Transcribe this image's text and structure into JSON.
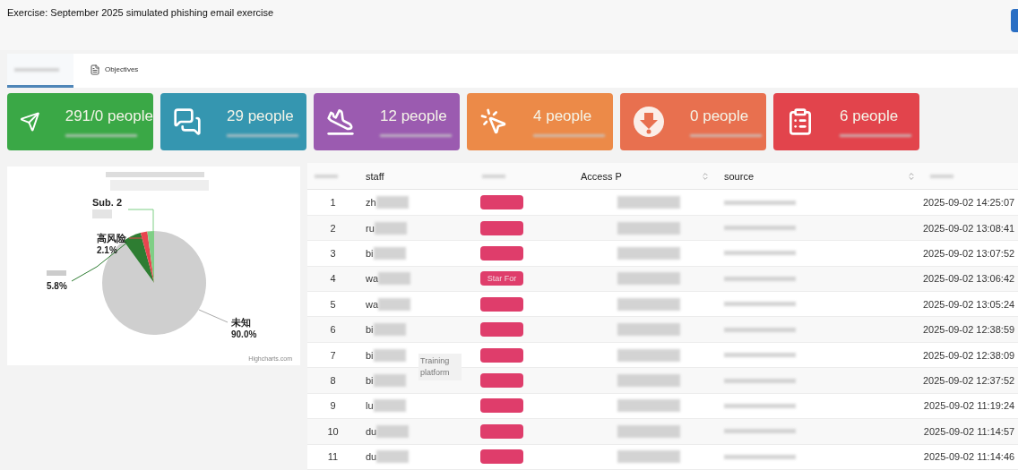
{
  "header": {
    "title": "Exercise: September 2025 simulated phishing email exercise"
  },
  "tabs": [
    {
      "selected": true
    },
    {
      "label": "Objectives",
      "selected": false
    }
  ],
  "cards": [
    {
      "kind": "sent",
      "value": "291/0 people",
      "color": "#3aa846"
    },
    {
      "kind": "opened",
      "value": "29 people",
      "color": "#3596b0"
    },
    {
      "kind": "landed",
      "value": "12 people",
      "color": "#9b5bb0"
    },
    {
      "kind": "clicked",
      "value": "4 people",
      "color": "#ec8a48"
    },
    {
      "kind": "downloaded",
      "value": "0 people",
      "color": "#e8704f"
    },
    {
      "kind": "reported",
      "value": "6 people",
      "color": "#e2444c"
    }
  ],
  "pie": {
    "credit": "Highcharts.com",
    "chart_data": {
      "type": "pie",
      "categories": [
        "未知",
        null,
        "高风险",
        "Sub. 2"
      ],
      "values": [
        90.0,
        5.8,
        2.1,
        2.1
      ],
      "value_labels": [
        "90.0%",
        "5.8%",
        "2.1%",
        null
      ],
      "colors": [
        "#cfcfcf",
        "#2e7d32",
        "#e8454f",
        "#7fcf86"
      ]
    }
  },
  "table": {
    "columns": [
      {
        "sortable": false
      },
      {
        "label": "staff",
        "sortable": false
      },
      {
        "sortable": false
      },
      {
        "label": "Access P",
        "sortable": true
      },
      {
        "label": "source",
        "sortable": true
      },
      {
        "sortable": false
      }
    ],
    "rows": [
      {
        "index": "1",
        "staff": "zh",
        "time": "2025-09-02 14:25:07"
      },
      {
        "index": "2",
        "staff": "ru",
        "time": "2025-09-02 13:08:41"
      },
      {
        "index": "3",
        "staff": "bi",
        "time": "2025-09-02 13:07:52"
      },
      {
        "index": "4",
        "staff": "wa",
        "badge": "Star For",
        "time": "2025-09-02 13:06:42"
      },
      {
        "index": "5",
        "staff": "wa",
        "time": "2025-09-02 13:05:24"
      },
      {
        "index": "6",
        "staff": "bi",
        "time": "2025-09-02 12:38:59"
      },
      {
        "index": "7",
        "staff": "bi",
        "time": "2025-09-02 12:38:09"
      },
      {
        "index": "8",
        "staff": "bi",
        "time": "2025-09-02 12:37:52"
      },
      {
        "index": "9",
        "staff": "lu",
        "time": "2025-09-02 11:19:24"
      },
      {
        "index": "10",
        "staff": "du",
        "time": "2025-09-02 11:14:57"
      },
      {
        "index": "11",
        "staff": "du",
        "time": "2025-09-02 11:14:46"
      }
    ],
    "overlay": "Training platform"
  }
}
